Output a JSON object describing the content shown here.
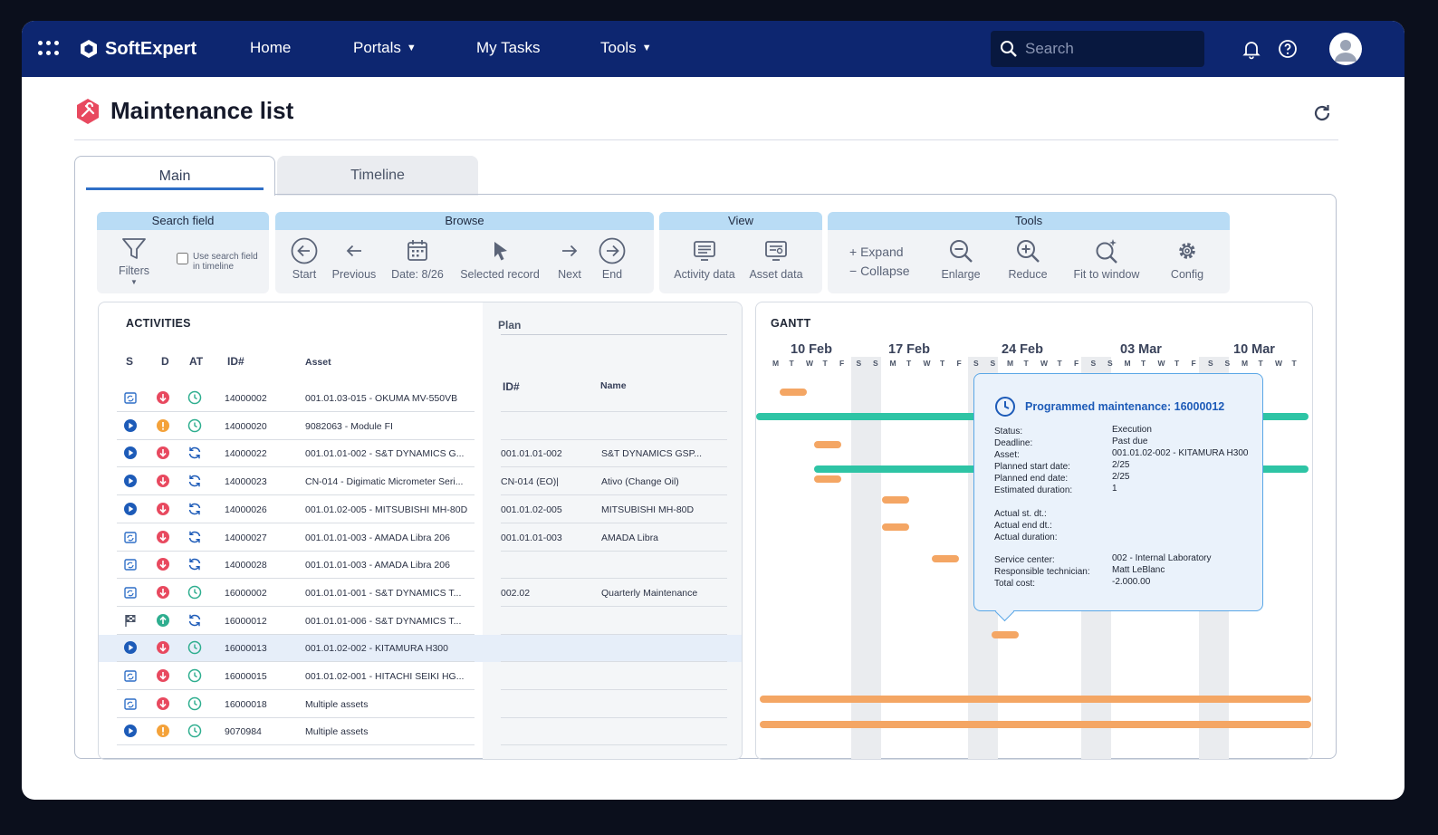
{
  "app": {
    "brand": "SoftExpert",
    "nav": [
      {
        "label": "Home"
      },
      {
        "label": "Portals"
      },
      {
        "label": "My Tasks"
      },
      {
        "label": "Tools"
      }
    ],
    "search_placeholder": "Search"
  },
  "page": {
    "title": "Maintenance list",
    "tabs": [
      {
        "label": "Main"
      },
      {
        "label": "Timeline"
      }
    ]
  },
  "toolbar": {
    "groups": [
      {
        "title": "Search field",
        "buttons": [
          {
            "label": "Filters"
          }
        ],
        "checkbox_label": "Use search field in timeline"
      },
      {
        "title": "Browse",
        "buttons": [
          {
            "label": "Start"
          },
          {
            "label": "Previous"
          },
          {
            "label": "Date: 8/26"
          },
          {
            "label": "Selected record"
          },
          {
            "label": "Next"
          },
          {
            "label": "End"
          }
        ]
      },
      {
        "title": "View",
        "buttons": [
          {
            "label": "Activity data"
          },
          {
            "label": "Asset data"
          }
        ]
      },
      {
        "title": "Tools",
        "buttons": [
          {
            "label": "+ Expand"
          },
          {
            "label": "− Collapse"
          },
          {
            "label": "Enlarge"
          },
          {
            "label": "Reduce"
          },
          {
            "label": "Fit to window"
          },
          {
            "label": "Config"
          }
        ]
      }
    ]
  },
  "activities": {
    "title": "ACTIVITIES",
    "plan_title": "Plan",
    "columns": [
      "S",
      "D",
      "AT",
      "ID#",
      "Asset"
    ],
    "plan_columns": [
      "ID#",
      "Name"
    ],
    "rows": [
      {
        "s": "calendar-repeat",
        "d": "down",
        "at": "clock",
        "id": "14000002",
        "asset": "001.01.03-015 - OKUMA MV-550VB",
        "plan_id": "",
        "plan_name": ""
      },
      {
        "s": "play",
        "d": "warning",
        "at": "clock",
        "id": "14000020",
        "asset": "9082063 - Module FI",
        "plan_id": "",
        "plan_name": ""
      },
      {
        "s": "play",
        "d": "down",
        "at": "cycle",
        "id": "14000022",
        "asset": "001.01.01-002 - S&T DYNAMICS G...",
        "plan_id": "001.01.01-002",
        "plan_name": "S&T DYNAMICS GSP..."
      },
      {
        "s": "play",
        "d": "down",
        "at": "cycle",
        "id": "14000023",
        "asset": "CN-014 - Digimatic Micrometer Seri...",
        "plan_id": "CN-014 (EO)|",
        "plan_name": "Ativo (Change Oil)"
      },
      {
        "s": "play",
        "d": "down",
        "at": "cycle",
        "id": "14000026",
        "asset": "001.01.02-005 - MITSUBISHI MH-80D",
        "plan_id": "001.01.02-005",
        "plan_name": "MITSUBISHI MH-80D"
      },
      {
        "s": "calendar-repeat",
        "d": "down",
        "at": "cycle",
        "id": "14000027",
        "asset": "001.01.01-003 - AMADA Libra 206",
        "plan_id": "001.01.01-003",
        "plan_name": "AMADA Libra"
      },
      {
        "s": "calendar-repeat",
        "d": "down",
        "at": "cycle",
        "id": "14000028",
        "asset": "001.01.01-003 - AMADA Libra 206",
        "plan_id": "",
        "plan_name": ""
      },
      {
        "s": "calendar-repeat",
        "d": "down",
        "at": "clock",
        "id": "16000002",
        "asset": "001.01.01-001 - S&T DYNAMICS T...",
        "plan_id": "002.02",
        "plan_name": "Quarterly Maintenance"
      },
      {
        "s": "flag",
        "d": "up",
        "at": "cycle",
        "id": "16000012",
        "asset": "001.01.01-006 - S&T DYNAMICS T...",
        "plan_id": "",
        "plan_name": ""
      },
      {
        "s": "play",
        "d": "down",
        "at": "clock",
        "id": "16000013",
        "asset": "001.01.02-002 - KITAMURA H300",
        "plan_id": "",
        "plan_name": "",
        "selected": true
      },
      {
        "s": "calendar-repeat",
        "d": "down",
        "at": "clock",
        "id": "16000015",
        "asset": "001.01.02-001 - HITACHI SEIKI HG...",
        "plan_id": "",
        "plan_name": ""
      },
      {
        "s": "calendar-repeat",
        "d": "down",
        "at": "clock",
        "id": "16000018",
        "asset": "Multiple assets",
        "plan_id": "",
        "plan_name": ""
      },
      {
        "s": "play",
        "d": "warning",
        "at": "clock",
        "id": "9070984",
        "asset": "Multiple assets",
        "plan_id": "",
        "plan_name": ""
      }
    ]
  },
  "gantt": {
    "title": "GANTT",
    "weeks": [
      "10 Feb",
      "17 Feb",
      "24 Feb",
      "03 Mar",
      "10 Mar"
    ],
    "day_letters": [
      "M",
      "T",
      "W",
      "T",
      "F",
      "S",
      "S",
      "M",
      "T",
      "W",
      "T",
      "F",
      "S",
      "S",
      "M",
      "T",
      "W",
      "T",
      "F",
      "S",
      "S",
      "M",
      "T",
      "W",
      "T",
      "F",
      "S",
      "S",
      "M",
      "T",
      "W",
      "T"
    ]
  },
  "tooltip": {
    "title": "Programmed maintenance: 16000012",
    "fields": [
      {
        "label": "Status:",
        "value": "Execution"
      },
      {
        "label": "Deadline:",
        "value": "Past due"
      },
      {
        "label": "Asset:",
        "value": "001.01.02-002 - KITAMURA H300"
      },
      {
        "label": "Planned start date:",
        "value": "2/25"
      },
      {
        "label": "Planned end date:",
        "value": "2/25"
      },
      {
        "label": "Estimated duration:",
        "value": "1"
      },
      {
        "label": "Actual st. dt.:",
        "value": ""
      },
      {
        "label": "Actual end dt.:",
        "value": ""
      },
      {
        "label": "Actual duration:",
        "value": ""
      },
      {
        "label": "Service center:",
        "value": "002 - Internal Laboratory"
      },
      {
        "label": "Responsible technician:",
        "value": "Matt LeBlanc"
      },
      {
        "label": "Total cost:",
        "value": "-2.000.00"
      }
    ]
  },
  "colors": {
    "topbar": "#0d2670",
    "accent": "#2f6fc7",
    "gantt_orange": "#f4a664",
    "gantt_teal": "#2ec4a5",
    "tooltip_border": "#5aa7e6"
  }
}
